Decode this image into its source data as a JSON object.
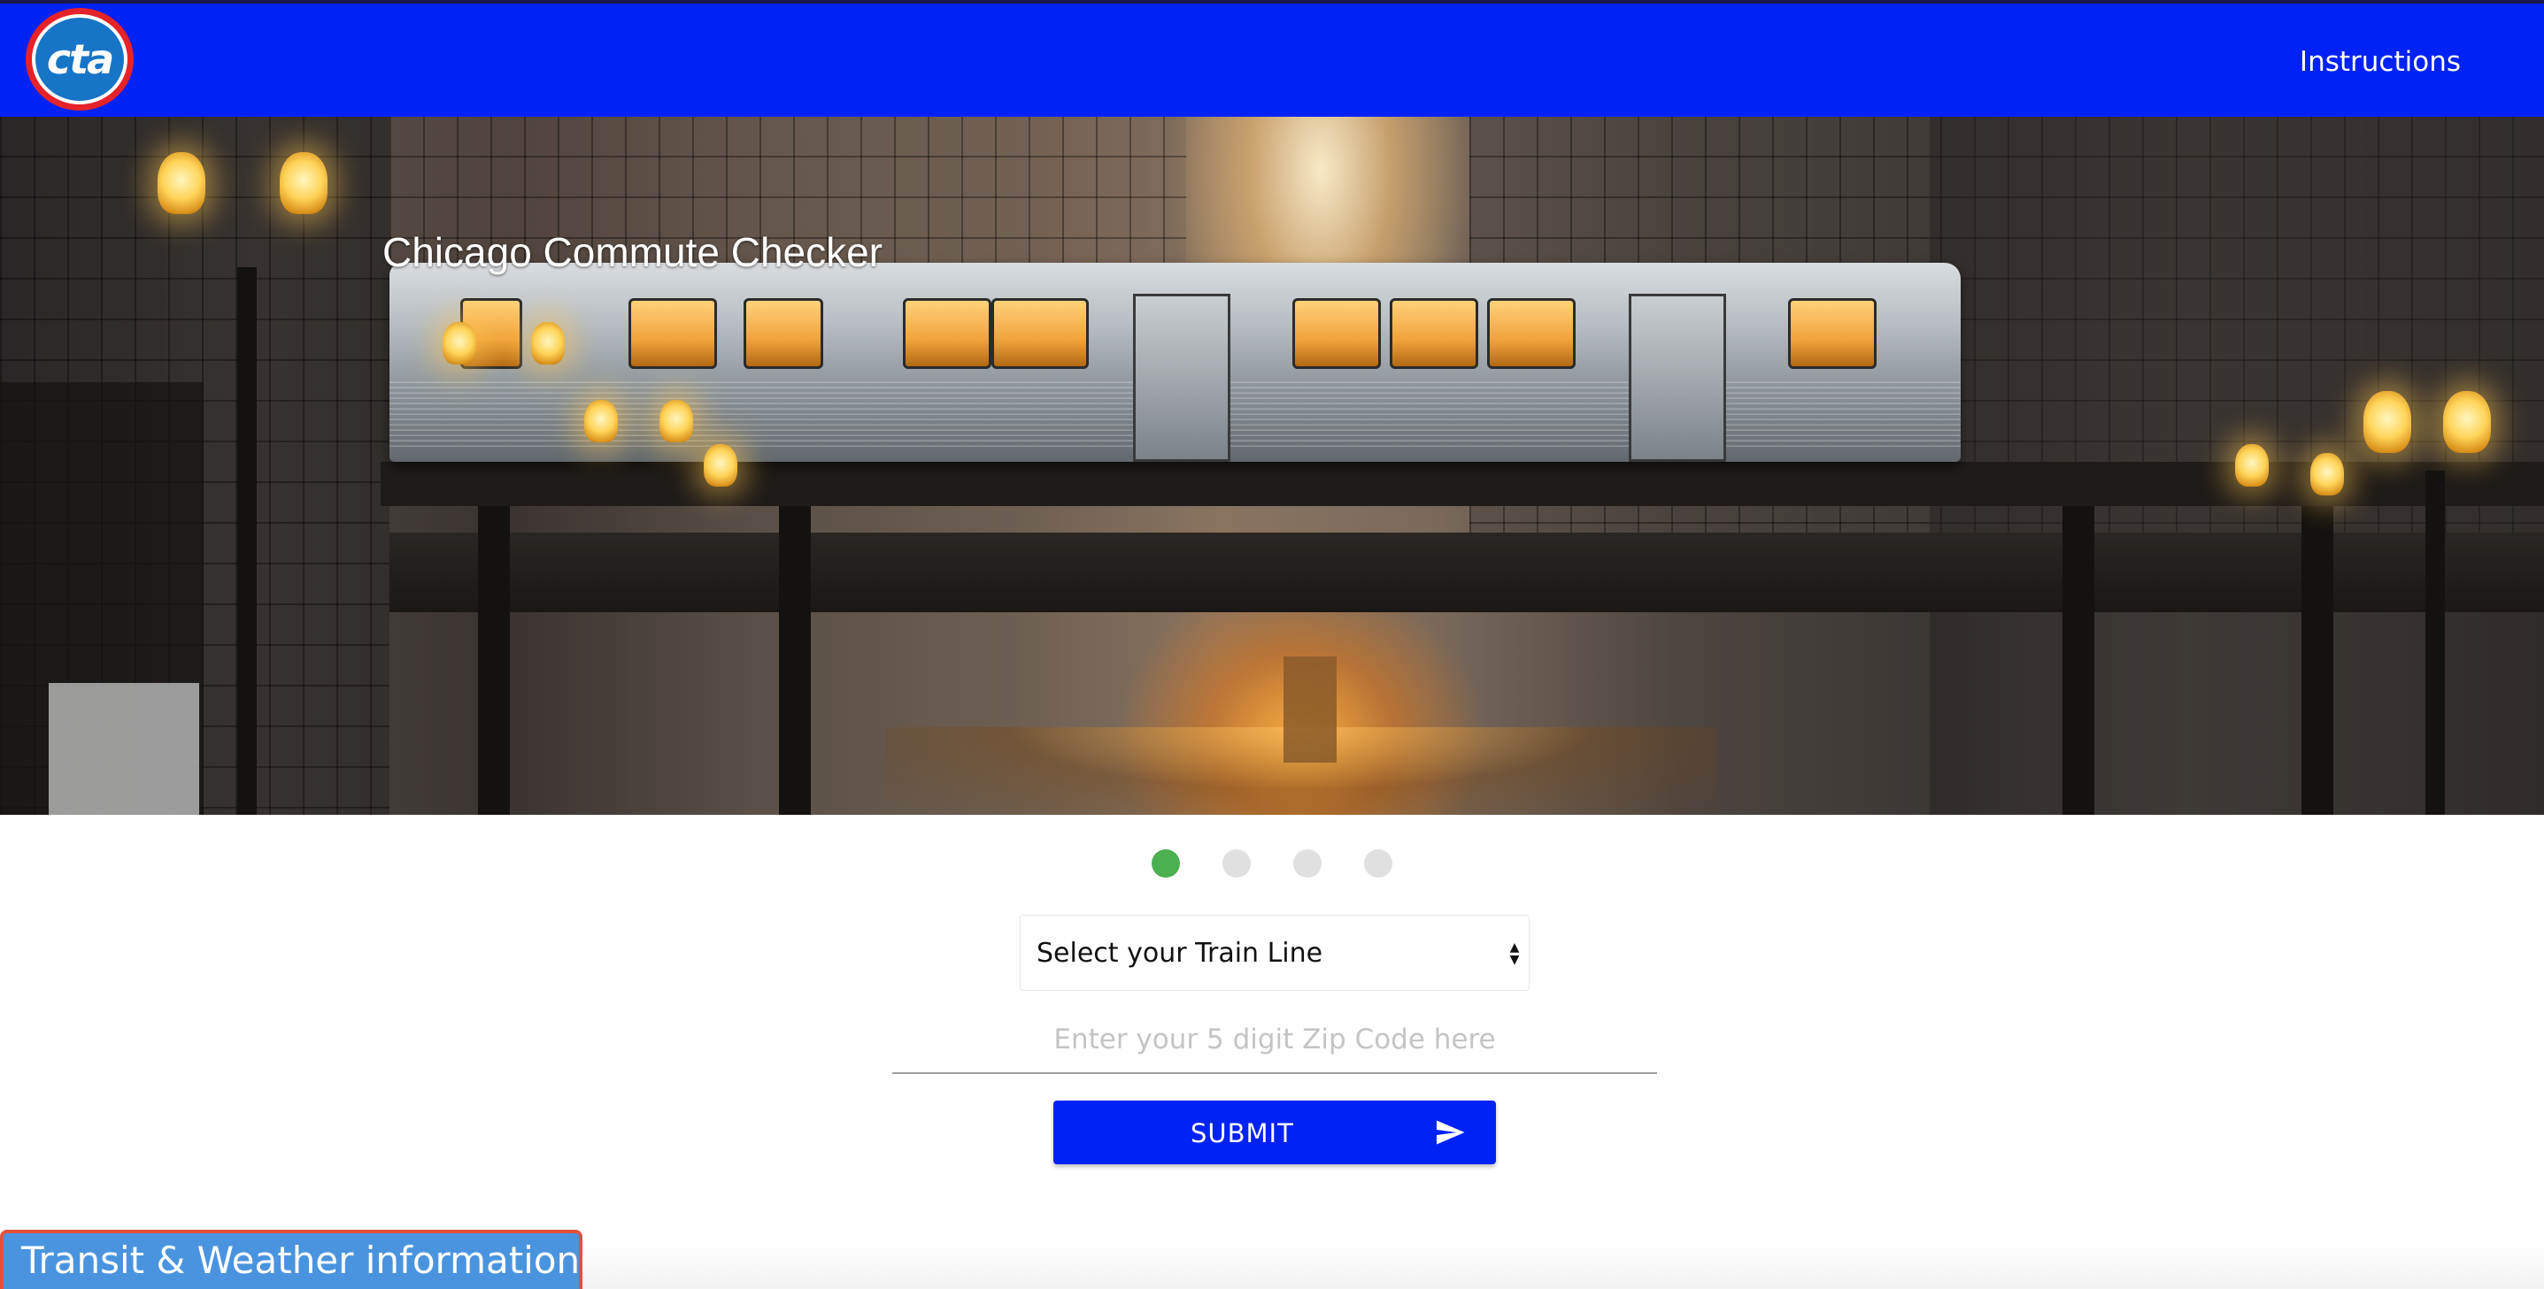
{
  "navbar": {
    "logo_text": "cta",
    "instructions_label": "Instructions"
  },
  "hero": {
    "title": "Chicago Commute Checker"
  },
  "carousel": {
    "slides": 4,
    "active_index": 0,
    "active_color": "#4caf50",
    "inactive_color": "#e0e0e0"
  },
  "form": {
    "train_line_select": {
      "selected_label": "Select your Train Line"
    },
    "zip_input": {
      "value": "",
      "placeholder": "Enter your 5 digit Zip Code here"
    },
    "submit_label": "SUBMIT"
  },
  "bottom_tab": {
    "label": "Transit & Weather information"
  },
  "colors": {
    "primary_blue": "#0022f5",
    "tab_blue": "#4a94df",
    "tab_border": "#e0533a",
    "logo_red": "#e52329",
    "logo_blue": "#1775c7"
  },
  "icons": {
    "submit_icon": "send-icon",
    "select_icon": "sort-arrows-icon"
  }
}
